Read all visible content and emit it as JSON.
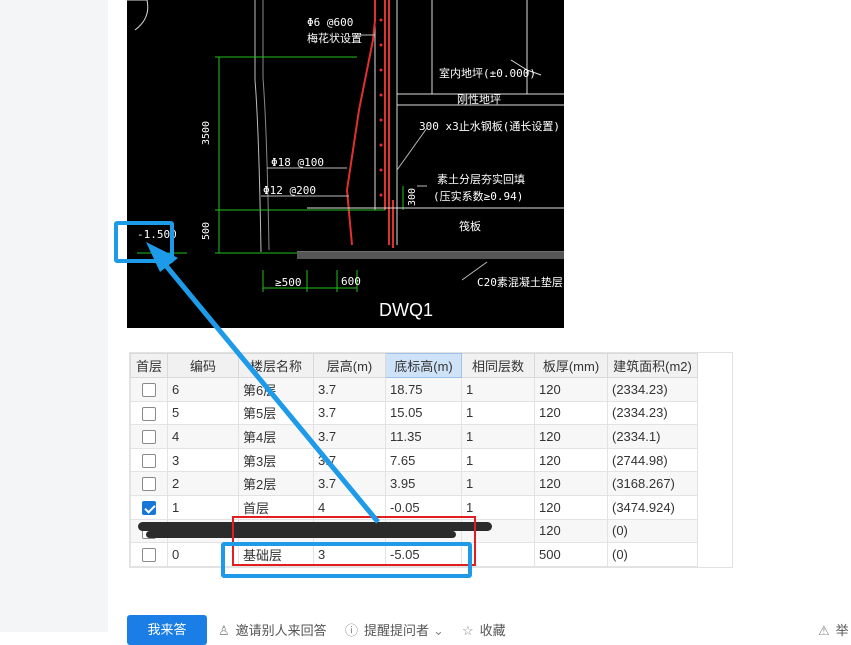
{
  "cad": {
    "labels": {
      "rebar_top": "Φ6 @600",
      "rebar_top_note": "梅花状设置",
      "floor_level": "室内地坪(±0.000)",
      "ground_beam": "刚性地坪",
      "waterstop": "300 x3止水钢板(通长设置)",
      "rebar_18": "Φ18 @100",
      "rebar_12": "Φ12 @200",
      "backfill_1": "素土分层夯实回填",
      "backfill_2": "(压实系数≥0.94)",
      "dim_3500": "3500",
      "dim_500": "500",
      "dim_300": "300",
      "raft": "筏板",
      "elevation": "-1.500",
      "dim_ge500": "≥500",
      "dim_600": "600",
      "cushion": "C20素混凝土垫层",
      "title": "DWQ1"
    }
  },
  "table": {
    "headers": [
      "首层",
      "编码",
      "楼层名称",
      "层高(m)",
      "底标高(m)",
      "相同层数",
      "板厚(mm)",
      "建筑面积(m2)"
    ],
    "selected_header_index": 4,
    "rows": [
      {
        "checked": false,
        "code": "6",
        "name": "第6层",
        "height": "3.7",
        "bottom": "18.75",
        "same": "1",
        "thick": "120",
        "area": "(2334.23)"
      },
      {
        "checked": false,
        "code": "5",
        "name": "第5层",
        "height": "3.7",
        "bottom": "15.05",
        "same": "1",
        "thick": "120",
        "area": "(2334.23)"
      },
      {
        "checked": false,
        "code": "4",
        "name": "第4层",
        "height": "3.7",
        "bottom": "11.35",
        "same": "1",
        "thick": "120",
        "area": "(2334.1)"
      },
      {
        "checked": false,
        "code": "3",
        "name": "第3层",
        "height": "3.7",
        "bottom": "7.65",
        "same": "1",
        "thick": "120",
        "area": "(2744.98)"
      },
      {
        "checked": false,
        "code": "2",
        "name": "第2层",
        "height": "3.7",
        "bottom": "3.95",
        "same": "1",
        "thick": "120",
        "area": "(3168.267)"
      },
      {
        "checked": true,
        "code": "1",
        "name": "首层",
        "height": "4",
        "bottom": "-0.05",
        "same": "1",
        "thick": "120",
        "area": "(3474.924)"
      },
      {
        "checked": false,
        "code": "",
        "name": "",
        "height": "",
        "bottom": "",
        "same": "",
        "thick": "120",
        "area": "(0)"
      },
      {
        "checked": false,
        "code": "0",
        "name": "基础层",
        "height": "3",
        "bottom": "-5.05",
        "same": "",
        "thick": "500",
        "area": "(0)"
      }
    ]
  },
  "actions": {
    "answer": "我来答",
    "invite": "邀请别人来回答",
    "remind": "提醒提问者",
    "collect": "收藏",
    "report": "举"
  },
  "colors": {
    "annotation_blue": "#1e9be8",
    "annotation_red": "#e02020",
    "button_blue": "#1a7ee6",
    "checkbox_blue": "#1677d6"
  }
}
